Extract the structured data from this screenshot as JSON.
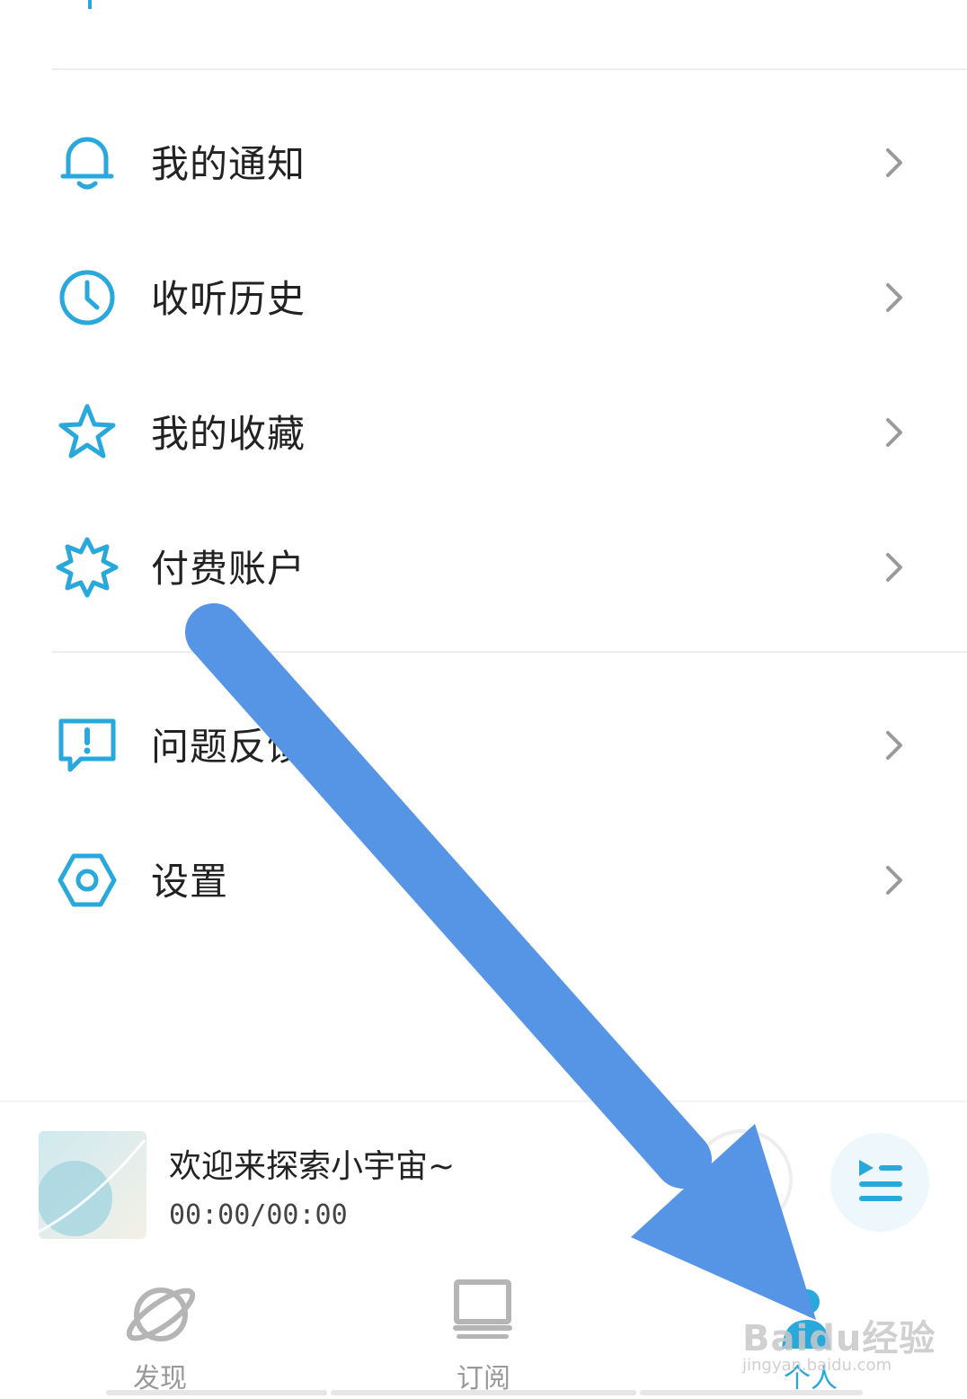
{
  "menu": {
    "items": [
      {
        "label": "我的通知",
        "icon": "bell-icon"
      },
      {
        "label": "收听历史",
        "icon": "clock-icon"
      },
      {
        "label": "我的收藏",
        "icon": "star-icon"
      },
      {
        "label": "付费账户",
        "icon": "badge-icon"
      },
      {
        "label": "问题反馈",
        "icon": "feedback-icon"
      },
      {
        "label": "设置",
        "icon": "settings-icon"
      }
    ]
  },
  "player": {
    "title": "欢迎来探索小宇宙~",
    "time": "00:00/00:00"
  },
  "nav": {
    "tabs": [
      {
        "label": "发现",
        "icon": "planet-icon"
      },
      {
        "label": "订阅",
        "icon": "subscribe-icon"
      },
      {
        "label": "个人",
        "icon": "profile-icon",
        "active": true
      }
    ]
  },
  "watermark": {
    "text": "Baidu经验",
    "sub": "jingyan.baidu.com"
  },
  "colors": {
    "accent": "#29a8dc",
    "annotation_arrow": "#5694e6"
  }
}
